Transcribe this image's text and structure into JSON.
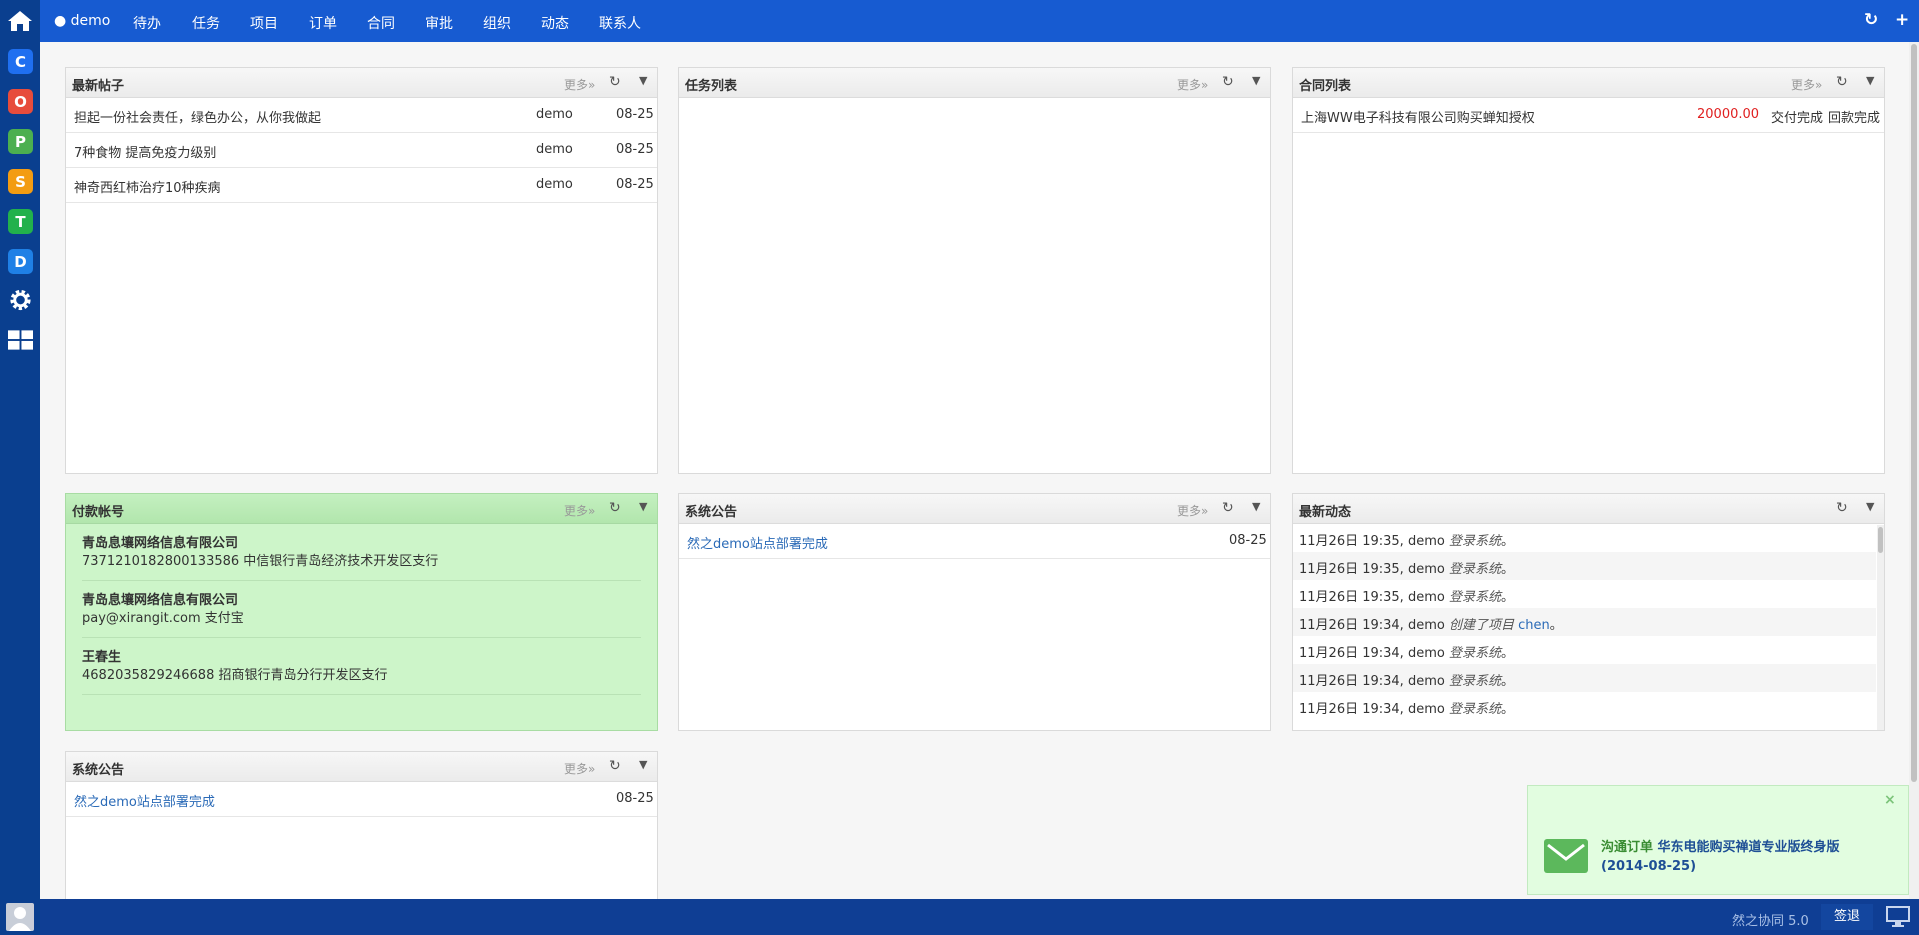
{
  "topbar": {
    "user": "demo",
    "nav": [
      "待办",
      "任务",
      "项目",
      "订单",
      "合同",
      "审批",
      "组织",
      "动态",
      "联系人"
    ]
  },
  "sidebar_apps": [
    {
      "name": "crm-app",
      "letter": "C",
      "color": "#1f6ff0"
    },
    {
      "name": "contract-app",
      "letter": "O",
      "color": "#e74c3c"
    },
    {
      "name": "project-app",
      "letter": "P",
      "color": "#4caf50"
    },
    {
      "name": "supply-app",
      "letter": "S",
      "color": "#f39c12"
    },
    {
      "name": "task-app",
      "letter": "T",
      "color": "#22b14c"
    },
    {
      "name": "doc-app",
      "letter": "D",
      "color": "#1f80e6"
    }
  ],
  "panels": {
    "posts": {
      "title": "最新帖子",
      "more": "更多»",
      "rows": [
        {
          "text": "担起一份社会责任，绿色办公，从你我做起",
          "author": "demo",
          "date": "08-25"
        },
        {
          "text": "7种食物 提高免疫力级别",
          "author": "demo",
          "date": "08-25"
        },
        {
          "text": "神奇西红柿治疗10种疾病",
          "author": "demo",
          "date": "08-25"
        }
      ]
    },
    "tasks": {
      "title": "任务列表",
      "more": "更多»"
    },
    "contracts": {
      "title": "合同列表",
      "more": "更多»",
      "rows": [
        {
          "name": "上海WW电子科技有限公司购买蝉知授权",
          "amount": "20000.00",
          "delivery": "交付完成",
          "payment": "回款完成"
        }
      ]
    },
    "accounts": {
      "title": "付款帐号",
      "more": "更多»",
      "rows": [
        {
          "name": "青岛息壤网络信息有限公司",
          "detail": "7371210182800133586 中信银行青岛经济技术开发区支行"
        },
        {
          "name": "青岛息壤网络信息有限公司",
          "detail": "pay@xirangit.com 支付宝"
        },
        {
          "name": "王春生",
          "detail": "4682035829246688 招商银行青岛分行开发区支行"
        }
      ]
    },
    "notice_mid": {
      "title": "系统公告",
      "more": "更多»",
      "rows": [
        {
          "text": "然之demo站点部署完成",
          "date": "08-25"
        }
      ]
    },
    "dynamics": {
      "title": "最新动态",
      "rows": [
        {
          "time": "11月26日 19:35, demo",
          "action": "登录系统",
          "tail": "。"
        },
        {
          "time": "11月26日 19:35, demo",
          "action": "登录系统",
          "tail": "。"
        },
        {
          "time": "11月26日 19:35, demo",
          "action": "登录系统",
          "tail": "。"
        },
        {
          "time": "11月26日 19:34, demo",
          "action": "创建了项目",
          "link": "chen",
          "tail": "。"
        },
        {
          "time": "11月26日 19:34, demo",
          "action": "登录系统",
          "tail": "。"
        },
        {
          "time": "11月26日 19:34, demo",
          "action": "登录系统",
          "tail": "。"
        },
        {
          "time": "11月26日 19:34, demo",
          "action": "登录系统",
          "tail": "。"
        }
      ]
    },
    "notice_bottom": {
      "title": "系统公告",
      "more": "更多»",
      "rows": [
        {
          "text": "然之demo站点部署完成",
          "date": "08-25"
        }
      ]
    }
  },
  "toast": {
    "label": "沟通订单",
    "text": "华东电能购买禅道专业版终身版",
    "date": "(2014-08-25)"
  },
  "bottombar": {
    "version": "然之协同 5.0",
    "sign": "签退"
  },
  "colors": {
    "topbar": "#175bd1",
    "sidebar": "#0a3f8f",
    "accent_red": "#e02020",
    "link": "#2a6ab7"
  }
}
